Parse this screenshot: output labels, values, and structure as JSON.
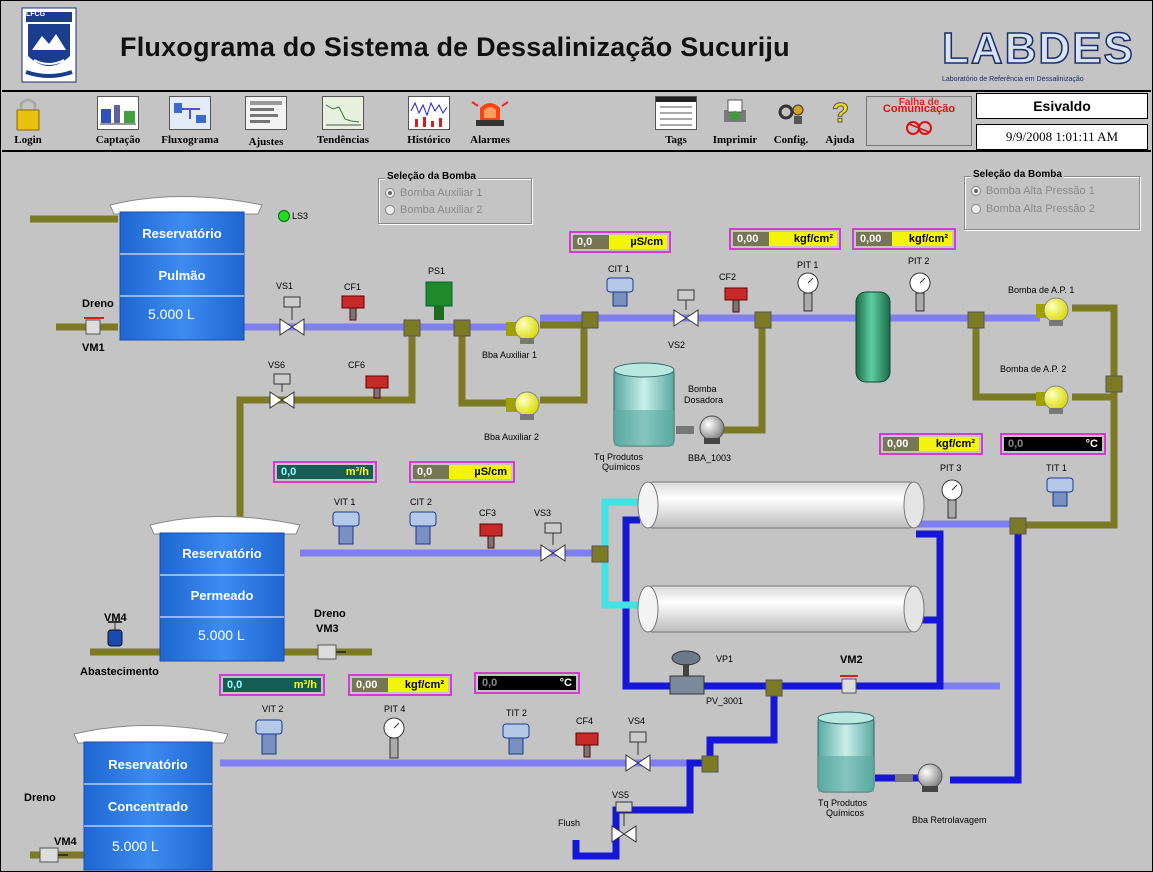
{
  "header": {
    "title": "Fluxograma do Sistema de Dessalinização Sucuriju",
    "left_logo_text": "LFCG",
    "right_logo_text": "LABDES",
    "right_logo_subtitle": "Laboratório de Referência em Dessalinização"
  },
  "toolbar": {
    "items": [
      {
        "label": "Login",
        "icon": "lock-icon"
      },
      {
        "label": "Captação",
        "icon": "intake-screen-icon"
      },
      {
        "label": "Fluxograma",
        "icon": "flowchart-screen-icon"
      },
      {
        "label": "Ajustes",
        "icon": "settings-screen-icon"
      },
      {
        "label": "Tendências",
        "icon": "trend-chart-icon"
      },
      {
        "label": "Histórico",
        "icon": "history-chart-icon"
      },
      {
        "label": "Alarmes",
        "icon": "alarm-beacon-icon"
      },
      {
        "label": "Tags",
        "icon": "tags-table-icon"
      },
      {
        "label": "Imprimir",
        "icon": "printer-icon"
      },
      {
        "label": "Config.",
        "icon": "config-icon"
      },
      {
        "label": "Ajuda",
        "icon": "help-icon"
      }
    ],
    "comm_status": "Comunicação",
    "comm_status_overlay": "Falha de",
    "user": "Esivaldo",
    "datetime": "9/9/2008 1:01:11 AM"
  },
  "pump_selection_aux": {
    "title": "Seleção da Bomba",
    "options": [
      "Bomba Auxiliar 1",
      "Bomba Auxiliar 2"
    ],
    "selected": "Bomba Auxiliar 1"
  },
  "pump_selection_hp": {
    "title": "Seleção da Bomba",
    "options": [
      "Bomba Alta Pressão 1",
      "Bomba Alta Pressão 2"
    ],
    "selected": "Bomba Alta Pressão 1"
  },
  "tanks": {
    "pulmao": {
      "name": "Reservatório",
      "subname": "Pulmão",
      "volume": "5.000 L"
    },
    "permeado": {
      "name": "Reservatório",
      "subname": "Permeado",
      "volume": "5.000 L"
    },
    "concentrado": {
      "name": "Reservatório",
      "subname": "Concentrado",
      "volume": "5.000 L"
    }
  },
  "readouts": {
    "cit1": {
      "value": "0,0",
      "unit": "µS/cm"
    },
    "pit1": {
      "value": "0,00",
      "unit": "kgf/cm²"
    },
    "pit2": {
      "value": "0,00",
      "unit": "kgf/cm²"
    },
    "pit3": {
      "value": "0,00",
      "unit": "kgf/cm²"
    },
    "tit1": {
      "value": "0,0",
      "unit": "°C"
    },
    "vit1": {
      "value": "0,0",
      "unit": "m³/h"
    },
    "cit2": {
      "value": "0,0",
      "unit": "µS/cm"
    },
    "vit2": {
      "value": "0,0",
      "unit": "m³/h"
    },
    "pit4": {
      "value": "0,00",
      "unit": "kgf/cm²"
    },
    "tit2": {
      "value": "0,0",
      "unit": "°C"
    }
  },
  "labels": {
    "ls3": "LS3",
    "ps1": "PS1",
    "vs1": "VS1",
    "vs2": "VS2",
    "vs3": "VS3",
    "vs4": "VS4",
    "vs5": "VS5",
    "vs6": "VS6",
    "cf1": "CF1",
    "cf2": "CF2",
    "cf3": "CF3",
    "cf4": "CF4",
    "cf6": "CF6",
    "cit1": "CIT 1",
    "cit2": "CIT 2",
    "pit1": "PIT 1",
    "pit2": "PIT 2",
    "pit3": "PIT 3",
    "pit4": "PIT 4",
    "tit1": "TIT 1",
    "tit2": "TIT 2",
    "vit1": "VIT 1",
    "vit2": "VIT 2",
    "vp1": "VP1",
    "pv3001": "PV_3001",
    "bba_aux1": "Bba Auxiliar 1",
    "bba_aux2": "Bba Auxiliar 2",
    "bomba_dosadora_1": "Bomba",
    "bomba_dosadora_2": "Dosadora",
    "bba1003": "BBA_1003",
    "tq_prod1_1": "Tq Produtos",
    "tq_prod1_2": "Químicos",
    "tq_prod2_1": "Tq Produtos",
    "tq_prod2_2": "Químicos",
    "bomba_ap1": "Bomba de A.P. 1",
    "bomba_ap2": "Bomba de A.P. 2",
    "bba_retro": "Bba Retrolavagem",
    "flush": "Flush",
    "dreno1": "Dreno",
    "vm1": "VM1",
    "dreno2": "Dreno",
    "vm3": "VM3",
    "vm4a": "VM4",
    "abastecimento": "Abastecimento",
    "dreno3": "Dreno",
    "vm4b": "VM4",
    "vm2": "VM2"
  },
  "colors": {
    "pipe_blue": "#7f7ff2",
    "pipe_olive": "#7d7a25",
    "pipe_dark_blue": "#1616d6",
    "pipe_cyan": "#42e2e2",
    "tank_blue": "#2a7ae8",
    "readout_border": "#d33bd3",
    "readout_yellow": "#f4f40a"
  }
}
